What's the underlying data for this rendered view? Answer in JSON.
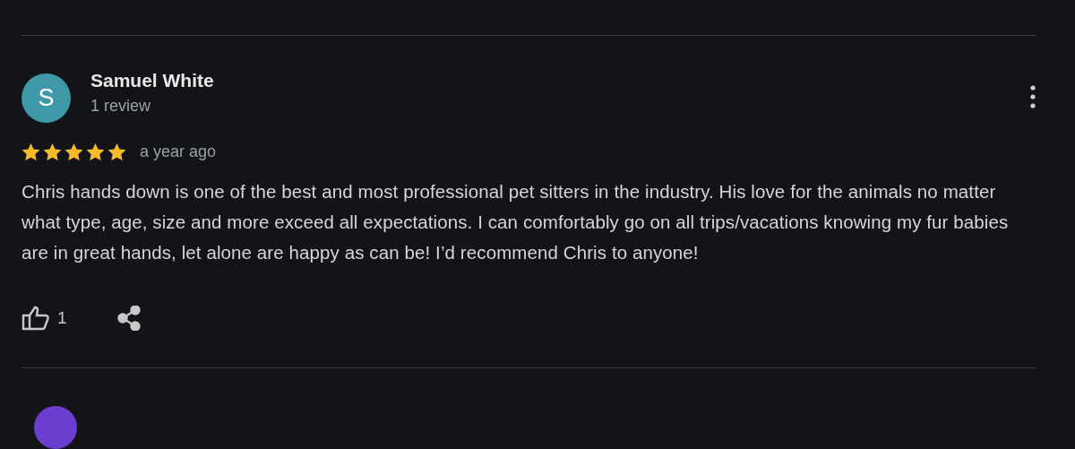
{
  "reviews": [
    {
      "avatar_letter": "S",
      "color": "#3f98a8",
      "name": "Samuel White",
      "review_count": "1 review",
      "stars": 5,
      "time": "a year ago",
      "text": "Chris hands down is one of the best and most professional pet sitters in the industry. His love for the animals no matter what type, age, size and more exceed all expectations. I can comfortably go on all trips/vacations knowing my fur babies are in great hands, let alone are happy as can be! I’d recommend Chris to anyone!",
      "likes": "1"
    },
    {
      "color": "#6a3fd0"
    }
  ]
}
